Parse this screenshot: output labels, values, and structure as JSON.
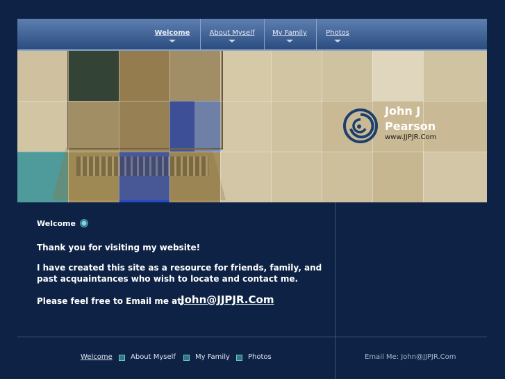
{
  "nav": {
    "items": [
      {
        "label": "Welcome"
      },
      {
        "label": "About Myself"
      },
      {
        "label": "My Family"
      },
      {
        "label": "Photos"
      }
    ]
  },
  "banner": {
    "name_line1": "John J",
    "name_line2": "Pearson",
    "url": "www.JJPJR.Com"
  },
  "content": {
    "title": "Welcome",
    "thanks": "Thank you for visiting my website!",
    "resource_line1": "I have created this site as a resource for friends, family,  and",
    "resource_line2": "past acquaintances who wish to locate and contact me.",
    "email_prompt": "Please feel free to Email me at:",
    "email": "John@JJPJR.Com"
  },
  "footer": {
    "links": [
      {
        "label": "Welcome"
      },
      {
        "label": "About Myself"
      },
      {
        "label": "My Family"
      },
      {
        "label": "Photos"
      }
    ],
    "email_text": "Email Me: John@JJPJR.Com"
  },
  "colors": {
    "background": "#0d2244",
    "nav_gradient_top": "#5d7fb0",
    "nav_gradient_bottom": "#2b4c80",
    "banner_tan": "#cdbf9c",
    "accent_blue": "#1f4fd6",
    "accent_teal": "#4f9a9a"
  },
  "icons": {
    "nav_indicator": "triangle-down-icon",
    "title_bullet": "radio-bullet-icon",
    "footer_separator": "square-bullet-icon",
    "logo": "swirl-logo-icon"
  }
}
